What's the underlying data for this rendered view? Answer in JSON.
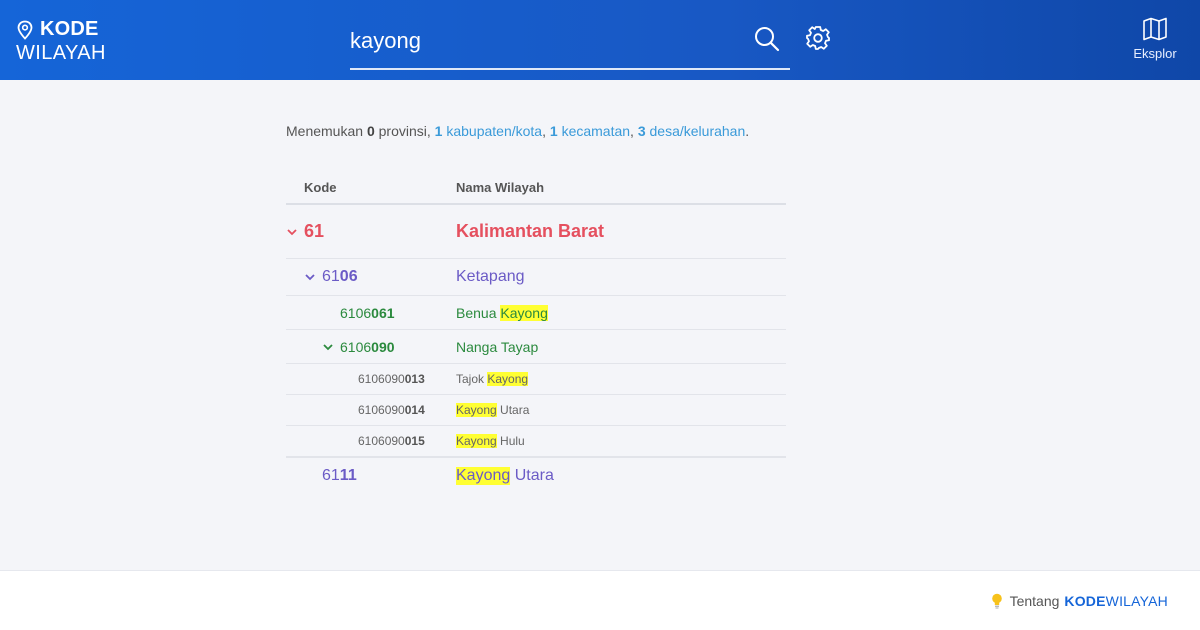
{
  "header": {
    "logo_line1": "KODE",
    "logo_line2": "WILAYAH",
    "search_value": "kayong",
    "explore_label": "Eksplor"
  },
  "summary": {
    "prefix": "Menemukan",
    "provinsi_count": "0",
    "provinsi_label": "provinsi,",
    "kab_count": "1",
    "kab_label": "kabupaten/kota",
    "kec_count": "1",
    "kec_label": "kecamatan",
    "desa_count": "3",
    "desa_label": "desa/kelurahan"
  },
  "table": {
    "col_code": "Kode",
    "col_name": "Nama Wilayah",
    "rows": [
      {
        "level": 1,
        "code_prefix": "",
        "code_suffix": "61",
        "name_pre": "Kalimantan Barat",
        "name_hl": "",
        "name_post": "",
        "expanded": true
      },
      {
        "level": 2,
        "code_prefix": "61",
        "code_suffix": "06",
        "name_pre": "Ketapang",
        "name_hl": "",
        "name_post": "",
        "expanded": true
      },
      {
        "level": 3,
        "code_prefix": "6106",
        "code_suffix": "061",
        "name_pre": "Benua ",
        "name_hl": "Kayong",
        "name_post": "",
        "expanded": false
      },
      {
        "level": 3,
        "code_prefix": "6106",
        "code_suffix": "090",
        "name_pre": "Nanga Tayap",
        "name_hl": "",
        "name_post": "",
        "expanded": true
      },
      {
        "level": 4,
        "code_prefix": "6106090",
        "code_suffix": "013",
        "name_pre": "Tajok ",
        "name_hl": "Kayong",
        "name_post": ""
      },
      {
        "level": 4,
        "code_prefix": "6106090",
        "code_suffix": "014",
        "name_pre": "",
        "name_hl": "Kayong",
        "name_post": " Utara"
      },
      {
        "level": 4,
        "code_prefix": "6106090",
        "code_suffix": "015",
        "name_pre": "",
        "name_hl": "Kayong",
        "name_post": " Hulu"
      },
      {
        "level": 2,
        "code_prefix": "61",
        "code_suffix": "11",
        "name_pre": "",
        "name_hl": "Kayong",
        "name_post": " Utara",
        "expanded": false
      }
    ]
  },
  "footer": {
    "about_label": "Tentang",
    "brand_bold": "KODE",
    "brand_rest": "WILAYAH"
  },
  "colors": {
    "header_blue": "#1565d8",
    "province_red": "#e5505f",
    "kabupaten_purple": "#6b5bc6",
    "kecamatan_green": "#2b8a3e",
    "highlight_yellow": "#ffff33",
    "link_blue": "#3a9ad9"
  },
  "icons": [
    "map-pin-icon",
    "search-icon",
    "gear-icon",
    "map-icon",
    "chevron-down-icon",
    "lightbulb-icon"
  ]
}
